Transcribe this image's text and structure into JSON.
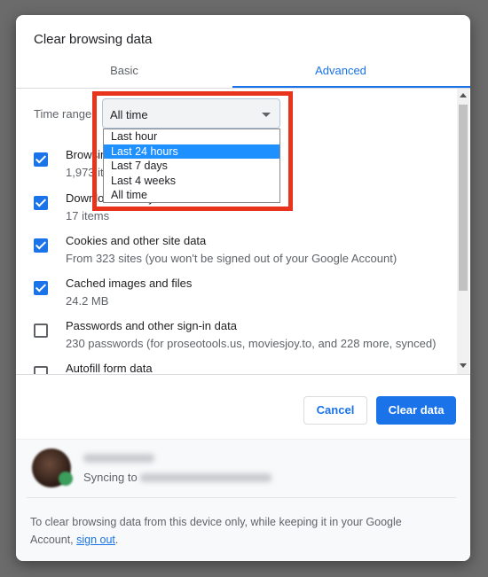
{
  "dialog": {
    "title": "Clear browsing data",
    "tabs": [
      {
        "label": "Basic",
        "active": false
      },
      {
        "label": "Advanced",
        "active": true
      }
    ]
  },
  "time_range": {
    "label": "Time range",
    "value": "All time",
    "options": [
      "Last hour",
      "Last 24 hours",
      "Last 7 days",
      "Last 4 weeks",
      "All time"
    ],
    "highlighted": "Last 24 hours"
  },
  "items": [
    {
      "title": "Browsing history",
      "detail": "1,973 items",
      "checked": true
    },
    {
      "title": "Download history",
      "detail": "17 items",
      "checked": true
    },
    {
      "title": "Cookies and other site data",
      "detail": "From 323 sites (you won't be signed out of your Google Account)",
      "checked": true
    },
    {
      "title": "Cached images and files",
      "detail": "24.2 MB",
      "checked": true
    },
    {
      "title": "Passwords and other sign-in data",
      "detail": "230 passwords (for proseotools.us, moviesjoy.to, and 228 more, synced)",
      "checked": false
    },
    {
      "title": "Autofill form data",
      "detail": "",
      "checked": false
    }
  ],
  "buttons": {
    "cancel": "Cancel",
    "clear": "Clear data"
  },
  "footer": {
    "syncing": "Syncing to",
    "note": "To clear browsing data from this device only, while keeping it in your Google Account,",
    "link": "sign out",
    "period": "."
  },
  "colors": {
    "accent": "#1a73e8",
    "highlight_box": "#e8341c"
  }
}
